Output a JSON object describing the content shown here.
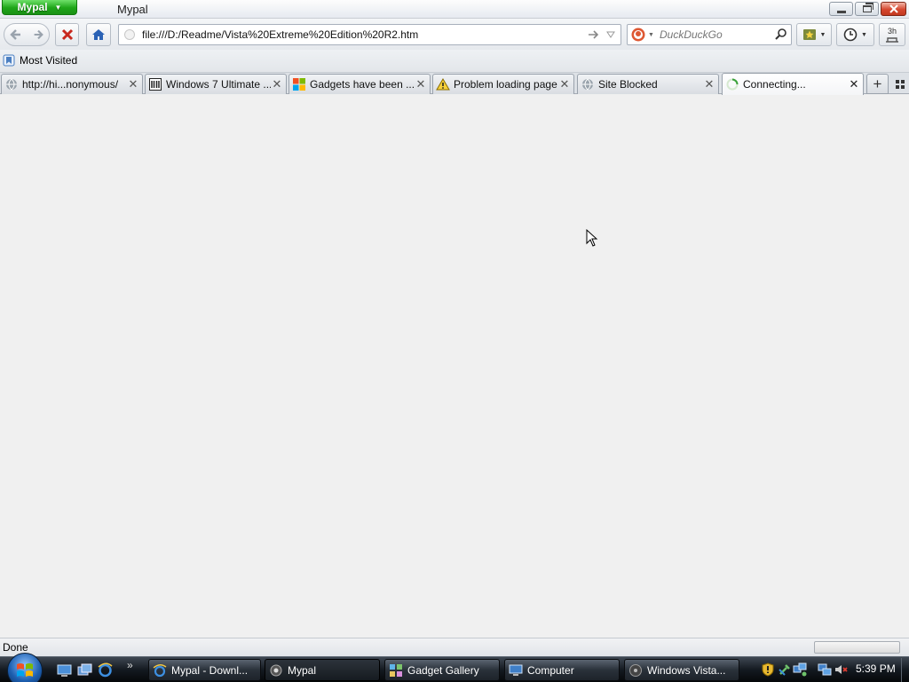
{
  "window": {
    "app_menu_label": "Mypal",
    "title": "Mypal"
  },
  "navbar": {
    "url": "file:///D:/Readme/Vista%20Extreme%20Edition%20R2.htm",
    "search_placeholder": "DuckDuckGo",
    "extra_button_label": "3h"
  },
  "bookmarks": {
    "items": [
      {
        "label": "Most Visited",
        "icon": "bookmark-folder-icon"
      }
    ]
  },
  "tabs": [
    {
      "label": "http://hi...nonymous/",
      "icon": "globe-icon"
    },
    {
      "label": "Windows 7 Ultimate ...",
      "icon": "site-favicon-icon"
    },
    {
      "label": "Gadgets have been ...",
      "icon": "windows-logo-icon"
    },
    {
      "label": "Problem loading page",
      "icon": "warning-icon"
    },
    {
      "label": "Site Blocked",
      "icon": "globe-icon"
    },
    {
      "label": "Connecting...",
      "icon": "loading-spinner-icon",
      "active": true
    }
  ],
  "status": {
    "text": "Done"
  },
  "taskbar": {
    "tasks": [
      {
        "label": "Mypal - Downl...",
        "icon": "ie-icon"
      },
      {
        "label": "Mypal",
        "icon": "mypal-icon",
        "active": true
      },
      {
        "label": "Gadget Gallery",
        "icon": "gadget-icon"
      },
      {
        "label": "Computer",
        "icon": "computer-icon"
      },
      {
        "label": "Windows Vista...",
        "icon": "media-icon"
      }
    ],
    "clock": "5:39 PM",
    "quicklaunch_more": "»"
  },
  "colors": {
    "app_menu": "#1ea619",
    "close_button": "#d5472f",
    "taskbar": "#141a21",
    "content_background": "#f0f0f0"
  }
}
